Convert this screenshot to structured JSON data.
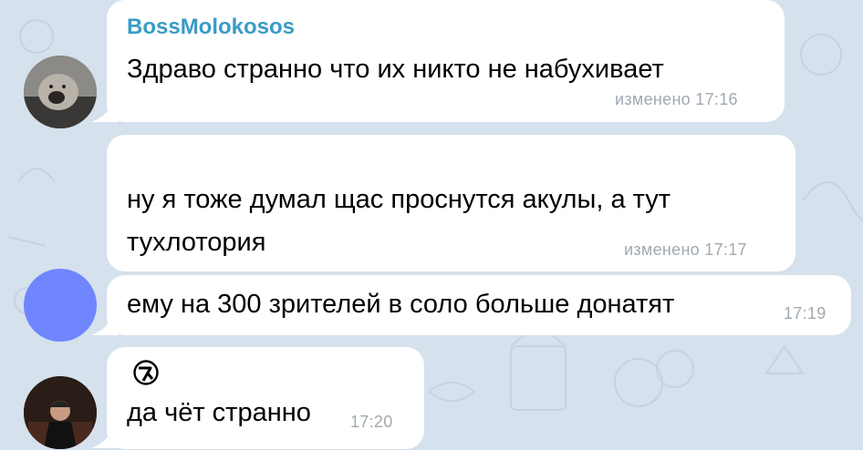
{
  "colors": {
    "background": "#d5e1ec",
    "bubble": "#ffffff",
    "sender_name": "#3a9bc6",
    "meta": "#a1a9b0",
    "avatar_blue": "#6f86ff"
  },
  "messages": [
    {
      "sender": "BossMolokosos",
      "text_lines": [
        "Здраво странно что их никто не набухивает"
      ],
      "meta": "изменено 17:16",
      "avatar": "lion-photo-avatar"
    },
    {
      "text_lines": [
        "ну я тоже думал щас проснутся акулы, а тут",
        "тухлотория"
      ],
      "meta": "изменено 17:17"
    },
    {
      "text_lines": [
        "ему на 300 зрителей в соло больше донатят"
      ],
      "meta": "17:19",
      "avatar": "blue-circle-avatar"
    },
    {
      "sticker_icon": "aphex-twin-logo-icon",
      "text_lines": [
        "да чёт странно"
      ],
      "meta": "17:20",
      "avatar": "man-in-suit-photo-avatar"
    }
  ]
}
